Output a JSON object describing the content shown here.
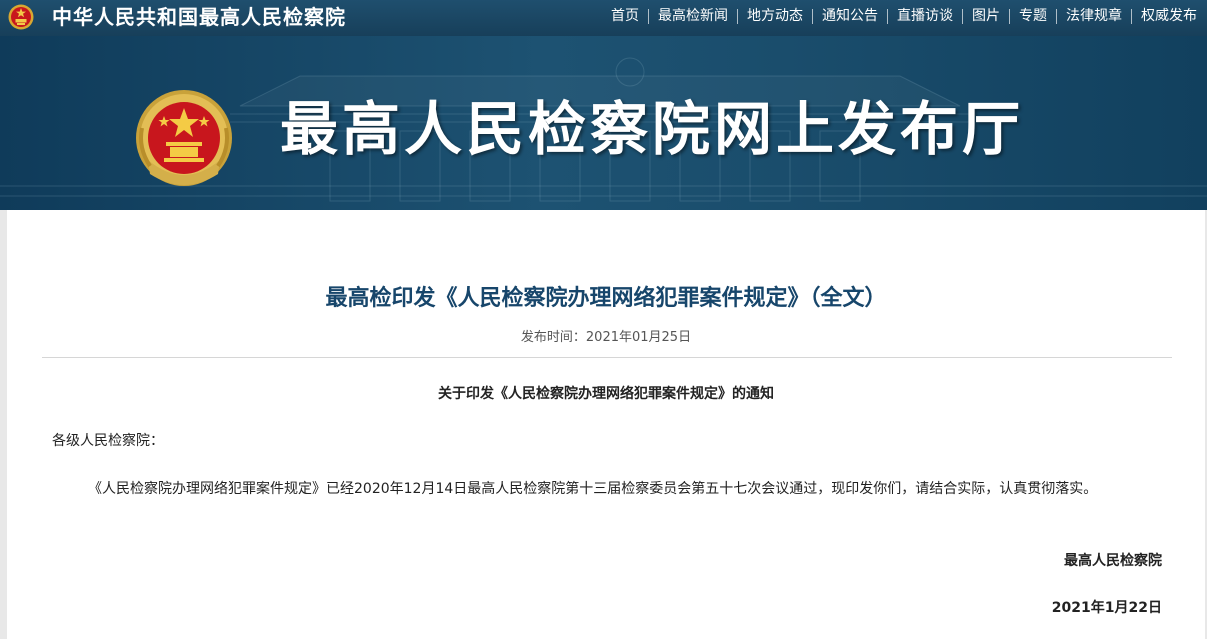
{
  "header": {
    "site_name": "中华人民共和国最高人民检察院",
    "emblem_icon": "procuratorate-emblem-icon",
    "colors": {
      "bar": "#1a4866",
      "text": "#ffffff"
    },
    "nav": [
      {
        "label": "首页"
      },
      {
        "label": "最高检新闻"
      },
      {
        "label": "地方动态"
      },
      {
        "label": "通知公告"
      },
      {
        "label": "直播访谈"
      },
      {
        "label": "图片"
      },
      {
        "label": "专题"
      },
      {
        "label": "法律规章"
      },
      {
        "label": "权威发布"
      }
    ]
  },
  "banner": {
    "title": "最高人民检察院网上发布厅",
    "emblem_icon": "procuratorate-emblem-icon",
    "colors": {
      "background": "#1d5272"
    }
  },
  "article": {
    "title": "最高检印发《人民检察院办理网络犯罪案件规定》（全文）",
    "publish_line": "发布时间：2021年01月25日",
    "notice_title": "关于印发《人民检察院办理网络犯罪案件规定》的通知",
    "salutation": "各级人民检察院：",
    "body": "《人民检察院办理网络犯罪案件规定》已经2020年12月14日最高人民检察院第十三届检察委员会第五十七次会议通过，现印发你们，请结合实际，认真贯彻落实。",
    "signer": "最高人民检察院",
    "sign_date": "2021年1月22日",
    "colors": {
      "title": "#17466b",
      "text": "#222222"
    }
  }
}
